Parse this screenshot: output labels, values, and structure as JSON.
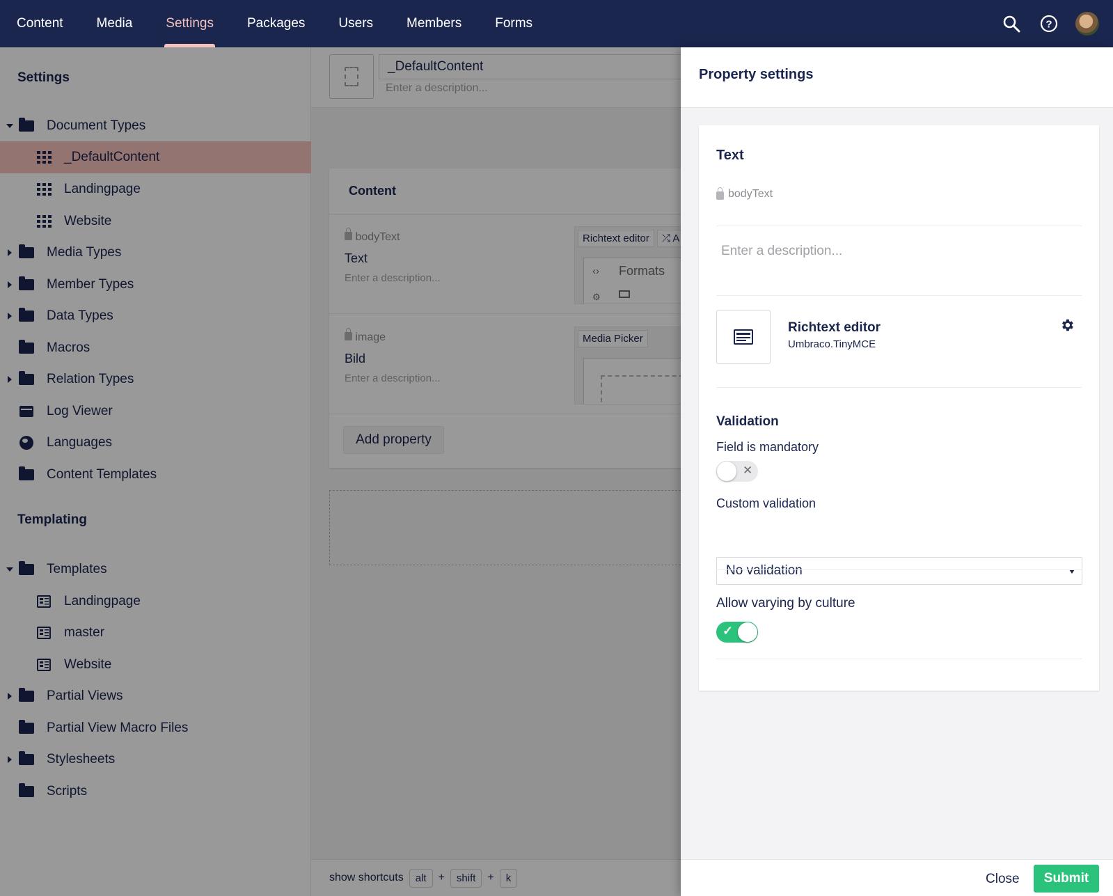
{
  "topnav": {
    "items": [
      "Content",
      "Media",
      "Settings",
      "Packages",
      "Users",
      "Members",
      "Forms"
    ],
    "active": "Settings"
  },
  "icons": {
    "search": "search-icon",
    "help": "help-icon",
    "user": "avatar"
  },
  "tree": {
    "settings_title": "Settings",
    "settings_items": [
      {
        "label": "Document Types",
        "caret": "down",
        "icon": "folder-icon"
      },
      {
        "label": "_DefaultContent",
        "icon": "doc-type-icon",
        "selected": true
      },
      {
        "label": "Landingpage",
        "icon": "doc-type-icon"
      },
      {
        "label": "Website",
        "icon": "doc-type-icon"
      },
      {
        "label": "Media Types",
        "caret": "right",
        "icon": "folder-icon"
      },
      {
        "label": "Member Types",
        "caret": "right",
        "icon": "folder-icon"
      },
      {
        "label": "Data Types",
        "caret": "right",
        "icon": "folder-icon"
      },
      {
        "label": "Macros",
        "icon": "folder-icon"
      },
      {
        "label": "Relation Types",
        "caret": "right",
        "icon": "folder-icon"
      },
      {
        "label": "Log Viewer",
        "icon": "box-icon"
      },
      {
        "label": "Languages",
        "icon": "globe-icon"
      },
      {
        "label": "Content Templates",
        "icon": "folder-icon"
      }
    ],
    "templating_title": "Templating",
    "templating_items": [
      {
        "label": "Templates",
        "caret": "down",
        "icon": "folder-icon"
      },
      {
        "label": "Landingpage",
        "icon": "template-icon"
      },
      {
        "label": "master",
        "icon": "template-icon"
      },
      {
        "label": "Website",
        "icon": "template-icon"
      },
      {
        "label": "Partial Views",
        "caret": "right",
        "icon": "folder-icon"
      },
      {
        "label": "Partial View Macro Files",
        "icon": "folder-icon"
      },
      {
        "label": "Stylesheets",
        "caret": "right",
        "icon": "folder-icon"
      },
      {
        "label": "Scripts",
        "icon": "folder-icon"
      }
    ]
  },
  "editor": {
    "name": "_DefaultContent",
    "description_placeholder": "Enter a description...",
    "group_title": "Content",
    "properties": [
      {
        "alias": "bodyText",
        "name": "Text",
        "description": "Enter a description...",
        "editor_tag": "Richtext editor",
        "editor_tag2": "⤮ A",
        "toolbar_formats": "Formats"
      },
      {
        "alias": "image",
        "name": "Bild",
        "description": "Enter a description...",
        "editor_tag": "Media Picker"
      }
    ],
    "add_property": "Add property",
    "footer": {
      "show_shortcuts": "show shortcuts",
      "keys": [
        "alt",
        "+",
        "shift",
        "+",
        "k"
      ]
    }
  },
  "panel": {
    "title": "Property settings",
    "property_name": "Text",
    "alias": "bodyText",
    "description_placeholder": "Enter a description...",
    "property_editor": {
      "name": "Richtext editor",
      "alias": "Umbraco.TinyMCE"
    },
    "validation": {
      "title": "Validation",
      "mandatory_label": "Field is mandatory",
      "mandatory": false,
      "custom_label": "Custom validation",
      "custom_value": "No validation"
    },
    "vary_by_culture": {
      "label": "Allow varying by culture",
      "enabled": true
    },
    "close_label": "Close",
    "submit_label": "Submit"
  },
  "colors": {
    "header": "#1b264f",
    "active_nav": "#f5c1bc",
    "selected_row": "#f5c1bc",
    "success": "#2bc37c"
  }
}
